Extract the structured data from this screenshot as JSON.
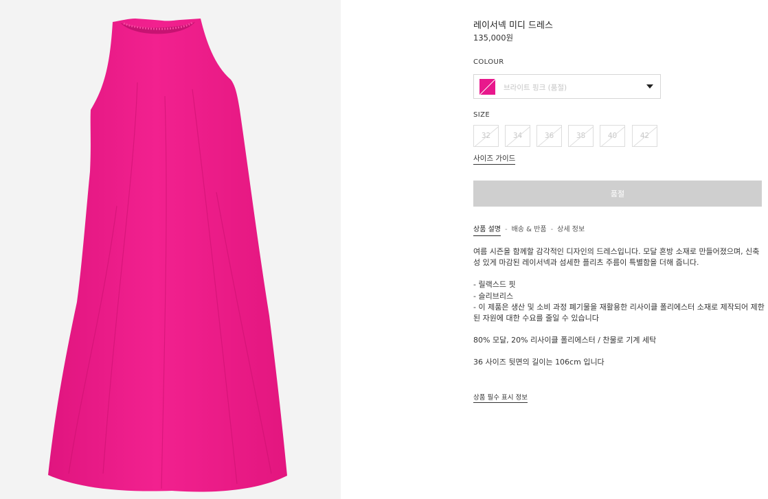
{
  "product": {
    "title": "레이서넥 미디 드레스",
    "price": "135,000원",
    "image_color": "#ec1b8f"
  },
  "colour": {
    "label": "COLOUR",
    "selected": "브라이트 핑크 (품절)",
    "swatch_color": "#e8188c"
  },
  "size": {
    "label": "SIZE",
    "options": [
      "32",
      "34",
      "36",
      "38",
      "40",
      "42"
    ],
    "guide_label": "사이즈 가이드"
  },
  "button": {
    "soldout_label": "품절"
  },
  "tabs": {
    "items": [
      "상품 설명",
      "배송 & 반품",
      "상세 정보"
    ],
    "separator": "-",
    "active_index": 0
  },
  "description": {
    "intro": "여름 시즌을 함께할 감각적인 디자인의 드레스입니다. 모달 혼방 소재로 만들어졌으며, 신축성 있게 마감된 레이서넥과 섬세한 플리츠 주름이 특별함을 더해 줍니다.",
    "features": [
      "- 릴랙스드 핏",
      "- 슬리브리스",
      "- 이 제품은 생산 및 소비 과정 폐기물을 재활용한 리사이클 폴리에스터 소재로 제작되어 제한된 자원에 대한 수요를 줄일 수 있습니다"
    ],
    "composition": "80% 모달, 20% 리사이클 폴리에스터 / 찬물로 기계 세탁",
    "length_note": "36 사이즈 뒷면의 길이는 106cm 입니다",
    "required_info_link": "상품 필수 표시 정보"
  }
}
